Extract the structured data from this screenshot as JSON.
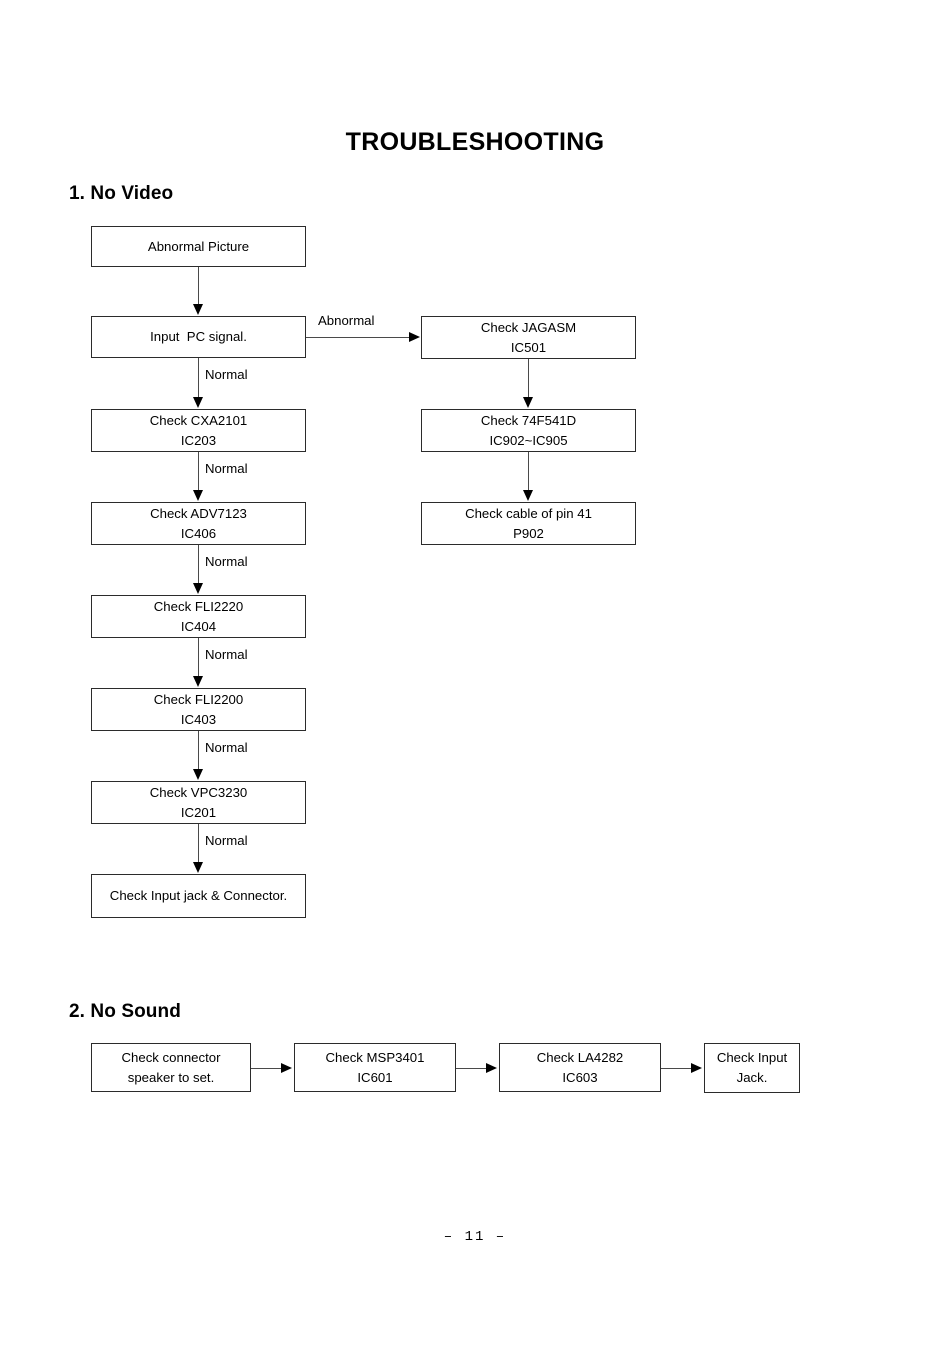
{
  "document": {
    "title": "TROUBLESHOOTING",
    "page_number": "–  11  –"
  },
  "sections": [
    {
      "id": "no-video",
      "heading": "1. No Video",
      "flow": {
        "left_column": [
          {
            "line1": "Abnormal Picture",
            "line2": ""
          },
          {
            "line1": "Input  PC signal.",
            "line2": ""
          },
          {
            "line1": "Check CXA2101",
            "line2": "IC203"
          },
          {
            "line1": "Check ADV7123",
            "line2": "IC406"
          },
          {
            "line1": "Check FLI2220",
            "line2": "IC404"
          },
          {
            "line1": "Check FLI2200",
            "line2": "IC403"
          },
          {
            "line1": "Check VPC3230",
            "line2": "IC201"
          },
          {
            "line1": "Check Input jack & Connector.",
            "line2": ""
          }
        ],
        "right_column": [
          {
            "line1": "Check JAGASM",
            "line2": "IC501"
          },
          {
            "line1": "Check 74F541D",
            "line2": "IC902~IC905"
          },
          {
            "line1": "Check cable of pin 41",
            "line2": "P902"
          }
        ],
        "edge_labels": {
          "branch_abnormal": "Abnormal",
          "normal_1": "Normal",
          "normal_2": "Normal",
          "normal_3": "Normal",
          "normal_4": "Normal",
          "normal_5": "Normal",
          "normal_6": "Normal"
        }
      }
    },
    {
      "id": "no-sound",
      "heading": "2. No Sound",
      "flow": {
        "chain": [
          {
            "line1": "Check connector",
            "line2": "speaker to set."
          },
          {
            "line1": "Check MSP3401",
            "line2": "IC601"
          },
          {
            "line1": "Check LA4282",
            "line2": "IC603"
          },
          {
            "line1": "Check Input",
            "line2": "Jack."
          }
        ]
      }
    }
  ],
  "colors": {
    "text": "#000000",
    "box_border": "#2b2b2b",
    "connector": "#4a4a4a",
    "background": "#ffffff"
  }
}
